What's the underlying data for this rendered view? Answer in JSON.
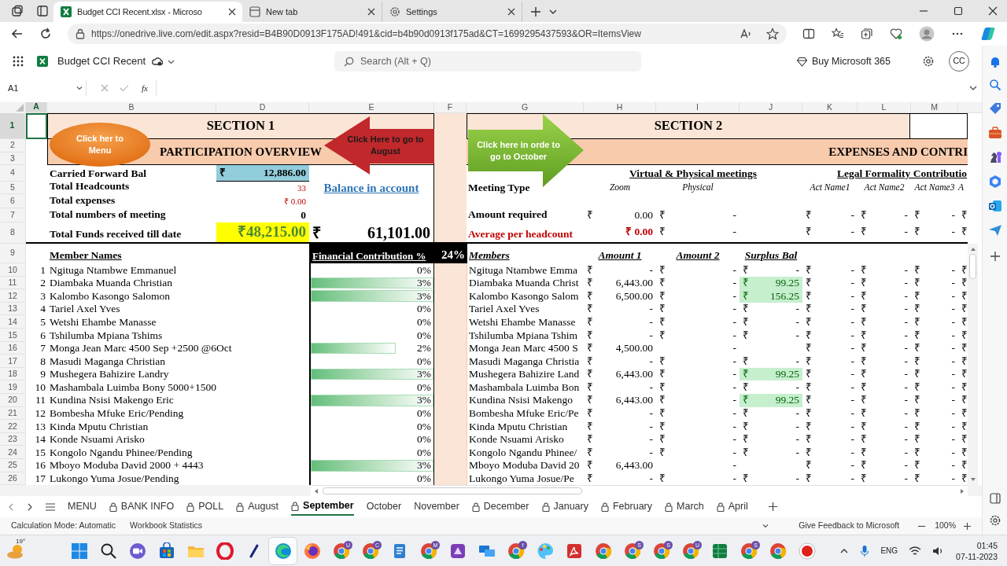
{
  "browser": {
    "tabs": [
      {
        "title": "Budget CCI Recent.xlsx - Microso",
        "kind": "excel",
        "selected": true
      },
      {
        "title": "New tab",
        "kind": "newtab",
        "selected": false
      },
      {
        "title": "Settings",
        "kind": "settings",
        "selected": false
      }
    ],
    "url": "https://onedrive.live.com/edit.aspx?resid=B4B90D0913F175AD!491&cid=b4b90d0913f175ad&CT=1699295437593&OR=ItemsView"
  },
  "app": {
    "title": "Budget CCI Recent",
    "search_placeholder": "Search (Alt + Q)",
    "buy": "Buy Microsoft 365",
    "avatar": "CC"
  },
  "formula_bar": {
    "name_box": "A1",
    "function_label": "fx"
  },
  "columns": [
    {
      "label": "A",
      "selected": true
    },
    {
      "label": "B",
      "selected": false
    },
    {
      "label": "D",
      "selected": false
    },
    {
      "label": "E",
      "selected": false
    },
    {
      "label": "F",
      "selected": false
    },
    {
      "label": "G",
      "selected": false
    },
    {
      "label": "H",
      "selected": false
    },
    {
      "label": "I",
      "selected": false
    },
    {
      "label": "J",
      "selected": false
    },
    {
      "label": "K",
      "selected": false
    },
    {
      "label": "L",
      "selected": false
    },
    {
      "label": "M",
      "selected": false
    }
  ],
  "row_numbers": [
    {
      "label": "1",
      "selected": true
    },
    {
      "label": "2",
      "selected": false
    },
    {
      "label": "3",
      "selected": false
    },
    {
      "label": "4",
      "selected": false
    },
    {
      "label": "5",
      "selected": false
    },
    {
      "label": "6",
      "selected": false
    },
    {
      "label": "7",
      "selected": false
    },
    {
      "label": "8",
      "selected": false
    },
    {
      "label": "9",
      "selected": false
    },
    {
      "label": "10",
      "selected": false
    },
    {
      "label": "11",
      "selected": false
    },
    {
      "label": "12",
      "selected": false
    },
    {
      "label": "13",
      "selected": false
    },
    {
      "label": "14",
      "selected": false
    },
    {
      "label": "15",
      "selected": false
    },
    {
      "label": "16",
      "selected": false
    },
    {
      "label": "17",
      "selected": false
    },
    {
      "label": "18",
      "selected": false
    },
    {
      "label": "19",
      "selected": false
    },
    {
      "label": "20",
      "selected": false
    },
    {
      "label": "21",
      "selected": false
    },
    {
      "label": "22",
      "selected": false
    },
    {
      "label": "23",
      "selected": false
    },
    {
      "label": "24",
      "selected": false
    },
    {
      "label": "25",
      "selected": false
    },
    {
      "label": "26",
      "selected": false
    }
  ],
  "section1": {
    "title": "SECTION 1",
    "subtitle": "PARTICIPATION OVERVIEW",
    "summary": [
      {
        "label": "Carried Forward Bal",
        "value": [
          "₹",
          "12,886.00"
        ],
        "kind": "blue"
      },
      {
        "label": "Total Headcounts",
        "value": [
          "33"
        ],
        "kind": "red"
      },
      {
        "label": "Total expenses",
        "value": [
          "₹ 0.00"
        ],
        "kind": "red"
      },
      {
        "label": "Total numbers of meeting",
        "value": [
          "0"
        ],
        "kind": "plain"
      },
      {
        "label": "Total Funds received till date",
        "value": [
          "₹48,215.00"
        ],
        "kind": "highlight"
      }
    ],
    "balance_label": "Balance in account",
    "balance_value": [
      "₹",
      "61,101.00"
    ],
    "names_header": "Member Names",
    "contribution_header": "Financial Contribution %",
    "contribution_total": "24%"
  },
  "section2": {
    "title": "SECTION 2",
    "subtitle": "EXPENSES AND CONTRI",
    "meetings_header": "Virtual & Physical meetings",
    "legal_header": "Legal Formality Contributio",
    "type_label": "Meeting Type",
    "types": [
      "Zoom",
      "Physical"
    ],
    "acts": [
      "Act Name1",
      "Act Name2",
      "Act Name3",
      "A"
    ],
    "required": {
      "label": "Amount required",
      "cells": [
        [
          "₹",
          "0.00"
        ],
        [
          "₹",
          "-"
        ]
      ],
      "acts": [
        [
          "₹",
          "-"
        ],
        [
          "₹",
          "-"
        ],
        [
          "₹",
          "-"
        ],
        [
          "₹"
        ]
      ]
    },
    "average": {
      "label": "Average per headcount",
      "cells": [
        [
          "₹ 0.00"
        ],
        [
          "₹",
          "-"
        ]
      ],
      "acts": [
        [
          "₹",
          "-"
        ],
        [
          "₹",
          "-"
        ],
        [
          "₹",
          "-"
        ],
        [
          "₹"
        ]
      ]
    },
    "members_header": "Members",
    "amount_headers": [
      "Amount 1",
      "Amount 2",
      "Surplus Bal"
    ]
  },
  "shapes": [
    {
      "kind": "ellipse",
      "text": "Click her to Menu"
    },
    {
      "kind": "arrow_left",
      "text": "Click Here to go to August"
    },
    {
      "kind": "arrow_right",
      "text": "Click here in orde to go to October"
    }
  ],
  "members": [
    {
      "no": "1",
      "name": "Ngituga Ntambwe Emmanuel",
      "pct": "0%",
      "short_name": "Ngituga Ntambwe Emma",
      "amount1": [
        "₹",
        "-"
      ],
      "amount2": [
        "₹",
        "-"
      ],
      "surplus": {
        "cells": [
          "₹",
          "-"
        ],
        "highlight": false
      },
      "acts": [
        [
          "₹",
          "-"
        ],
        [
          "₹",
          "-"
        ],
        [
          "₹",
          "-"
        ],
        [
          "₹"
        ]
      ]
    },
    {
      "no": "2",
      "name": "Diambaka Muanda Christian",
      "pct": "3%",
      "level": 1,
      "short_name": "Diambaka Muanda Christ",
      "amount1": [
        "₹",
        "6,443.00"
      ],
      "amount2": [
        "₹",
        "-"
      ],
      "surplus": {
        "cells": [
          "₹",
          "99.25"
        ],
        "highlight": true
      },
      "acts": [
        [
          "₹",
          "-"
        ],
        [
          "₹",
          "-"
        ],
        [
          "₹",
          "-"
        ],
        [
          "₹"
        ]
      ]
    },
    {
      "no": "3",
      "name": "Kalombo Kasongo Salomon",
      "pct": "3%",
      "level": 1,
      "short_name": "Kalombo Kasongo Salom",
      "amount1": [
        "₹",
        "6,500.00"
      ],
      "amount2": [
        "₹",
        "-"
      ],
      "surplus": {
        "cells": [
          "₹",
          "156.25"
        ],
        "highlight": true
      },
      "acts": [
        [
          "₹",
          "-"
        ],
        [
          "₹",
          "-"
        ],
        [
          "₹",
          "-"
        ],
        [
          "₹"
        ]
      ]
    },
    {
      "no": "4",
      "name": "Tariel Axel Yves",
      "pct": "0%",
      "short_name": "Tariel Axel Yves",
      "amount1": [
        "₹",
        "-"
      ],
      "amount2": [
        "₹",
        "-"
      ],
      "surplus": {
        "cells": [
          "₹",
          "-"
        ],
        "highlight": false
      },
      "acts": [
        [
          "₹",
          "-"
        ],
        [
          "₹",
          "-"
        ],
        [
          "₹",
          "-"
        ],
        [
          "₹"
        ]
      ]
    },
    {
      "no": "5",
      "name": "Wetshi Ehambe Manasse",
      "pct": "0%",
      "short_name": "Wetshi Ehambe Manasse",
      "amount1": [
        "₹",
        "-"
      ],
      "amount2": [
        "₹",
        "-"
      ],
      "surplus": {
        "cells": [
          "₹",
          "-"
        ],
        "highlight": false
      },
      "acts": [
        [
          "₹",
          "-"
        ],
        [
          "₹",
          "-"
        ],
        [
          "₹",
          "-"
        ],
        [
          "₹"
        ]
      ]
    },
    {
      "no": "6",
      "name": "Tshilumba Mpiana Tshims",
      "pct": "0%",
      "short_name": "Tshilumba Mpiana Tshim",
      "amount1": [
        "₹",
        "-"
      ],
      "amount2": [
        "₹",
        "-"
      ],
      "surplus": {
        "cells": [
          "₹",
          "-"
        ],
        "highlight": false
      },
      "acts": [
        [
          "₹",
          "-"
        ],
        [
          "₹",
          "-"
        ],
        [
          "₹",
          "-"
        ],
        [
          "₹"
        ]
      ]
    },
    {
      "no": "7",
      "name": "Monga Jean Marc 4500 Sep +2500 @6Oct",
      "pct": "2%",
      "level": 0.69,
      "short_name": "Monga Jean Marc 4500 S",
      "amount1": [
        "₹",
        "4,500.00"
      ],
      "amount2": [
        "-"
      ],
      "acts": [
        [
          "₹",
          "-"
        ],
        [
          "₹",
          "-"
        ],
        [
          "₹",
          "-"
        ],
        [
          "₹"
        ]
      ]
    },
    {
      "no": "8",
      "name": "Masudi Maganga Christian",
      "pct": "0%",
      "short_name": "Masudi Maganga Christia",
      "amount1": [
        "₹",
        "-"
      ],
      "amount2": [
        "₹",
        "-"
      ],
      "surplus": {
        "cells": [
          "₹",
          "-"
        ],
        "highlight": false
      },
      "acts": [
        [
          "₹",
          "-"
        ],
        [
          "₹",
          "-"
        ],
        [
          "₹",
          "-"
        ],
        [
          "₹"
        ]
      ]
    },
    {
      "no": "9",
      "name": "Mushegera Bahizire Landry",
      "pct": "3%",
      "level": 1,
      "short_name": "Mushegera Bahizire Land",
      "amount1": [
        "₹",
        "6,443.00"
      ],
      "amount2": [
        "₹",
        "-"
      ],
      "surplus": {
        "cells": [
          "₹",
          "99.25"
        ],
        "highlight": true
      },
      "acts": [
        [
          "₹",
          "-"
        ],
        [
          "₹",
          "-"
        ],
        [
          "₹",
          "-"
        ],
        [
          "₹"
        ]
      ]
    },
    {
      "no": "10",
      "name": "Mashambala Luimba Bony 5000+1500",
      "pct": "0%",
      "short_name": "Mashambala Luimba Bon",
      "amount1": [
        "₹",
        "-"
      ],
      "amount2": [
        "₹",
        "-"
      ],
      "surplus": {
        "cells": [
          "₹",
          "-"
        ],
        "highlight": false
      },
      "acts": [
        [
          "₹",
          "-"
        ],
        [
          "₹",
          "-"
        ],
        [
          "₹",
          "-"
        ],
        [
          "₹"
        ]
      ]
    },
    {
      "no": "11",
      "name": "Kundina Nsisi Makengo Eric",
      "pct": "3%",
      "level": 1,
      "short_name": "Kundina Nsisi Makengo",
      "amount1": [
        "₹",
        "6,443.00"
      ],
      "amount2": [
        "₹",
        "-"
      ],
      "surplus": {
        "cells": [
          "₹",
          "99.25"
        ],
        "highlight": true
      },
      "acts": [
        [
          "₹",
          "-"
        ],
        [
          "₹",
          "-"
        ],
        [
          "₹",
          "-"
        ],
        [
          "₹"
        ]
      ]
    },
    {
      "no": "12",
      "name": "Bombesha Mfuke Eric/Pending",
      "pct": "0%",
      "short_name": "Bombesha Mfuke Eric/Pe",
      "amount1": [
        "₹",
        "-"
      ],
      "amount2": [
        "₹",
        "-"
      ],
      "surplus": {
        "cells": [
          "₹",
          "-"
        ],
        "highlight": false
      },
      "acts": [
        [
          "₹",
          "-"
        ],
        [
          "₹",
          "-"
        ],
        [
          "₹",
          "-"
        ],
        [
          "₹"
        ]
      ]
    },
    {
      "no": "13",
      "name": "Kinda Mputu Christian",
      "pct": "0%",
      "short_name": "Kinda Mputu Christian",
      "amount1": [
        "₹",
        "-"
      ],
      "amount2": [
        "₹",
        "-"
      ],
      "surplus": {
        "cells": [
          "₹",
          "-"
        ],
        "highlight": false
      },
      "acts": [
        [
          "₹",
          "-"
        ],
        [
          "₹",
          "-"
        ],
        [
          "₹",
          "-"
        ],
        [
          "₹"
        ]
      ]
    },
    {
      "no": "14",
      "name": "Konde Nsuami Arisko",
      "pct": "0%",
      "short_name": "Konde Nsuami Arisko",
      "amount1": [
        "₹",
        "-"
      ],
      "amount2": [
        "₹",
        "-"
      ],
      "surplus": {
        "cells": [
          "₹",
          "-"
        ],
        "highlight": false
      },
      "acts": [
        [
          "₹",
          "-"
        ],
        [
          "₹",
          "-"
        ],
        [
          "₹",
          "-"
        ],
        [
          "₹"
        ]
      ]
    },
    {
      "no": "15",
      "name": "Kongolo Ngandu Phinee/Pending",
      "pct": "0%",
      "short_name": "Kongolo Ngandu Phinee/",
      "amount1": [
        "₹",
        "-"
      ],
      "amount2": [
        "₹",
        "-"
      ],
      "surplus": {
        "cells": [
          "₹",
          "-"
        ],
        "highlight": false
      },
      "acts": [
        [
          "₹",
          "-"
        ],
        [
          "₹",
          "-"
        ],
        [
          "₹",
          "-"
        ],
        [
          "₹"
        ]
      ]
    },
    {
      "no": "16",
      "name": "Mboyo Moduba David 2000 + 4443",
      "pct": "3%",
      "level": 1,
      "short_name": "Mboyo Moduba David 20",
      "amount1": [
        "₹",
        "6,443.00"
      ],
      "amount2": [
        "-"
      ],
      "acts": [
        [
          "₹",
          "-"
        ],
        [
          "₹",
          "-"
        ],
        [
          "₹",
          "-"
        ],
        [
          "₹"
        ]
      ]
    },
    {
      "no": "17",
      "name": "Lukongo Yuma Josue/Pending",
      "pct": "0%",
      "short_name": "Lukongo Yuma Josue/Pe",
      "amount1": [
        "₹",
        "-"
      ],
      "amount2": [
        "₹",
        "-"
      ],
      "surplus": {
        "cells": [
          "₹",
          "-"
        ],
        "highlight": false
      },
      "acts": [
        [
          "₹",
          "-"
        ],
        [
          "₹",
          "-"
        ],
        [
          "₹",
          "-"
        ],
        [
          "₹"
        ]
      ]
    }
  ],
  "sheet_tabs": [
    {
      "label": "MENU",
      "locked": false,
      "selected": false
    },
    {
      "label": "BANK INFO",
      "locked": true,
      "selected": false
    },
    {
      "label": "POLL",
      "locked": true,
      "selected": false
    },
    {
      "label": "August",
      "locked": true,
      "selected": false
    },
    {
      "label": "September",
      "locked": true,
      "selected": true
    },
    {
      "label": "October",
      "locked": false,
      "selected": false
    },
    {
      "label": "November",
      "locked": false,
      "selected": false
    },
    {
      "label": "December",
      "locked": true,
      "selected": false
    },
    {
      "label": "January",
      "locked": true,
      "selected": false
    },
    {
      "label": "February",
      "locked": true,
      "selected": false
    },
    {
      "label": "March",
      "locked": true,
      "selected": false
    },
    {
      "label": "April",
      "locked": true,
      "selected": false
    }
  ],
  "status_bar": {
    "items": [
      "Calculation Mode: Automatic",
      "Workbook Statistics"
    ],
    "feedback": "Give Feedback to Microsoft",
    "zoom": "100%"
  },
  "taskbar": {
    "weather": "19°",
    "apps": [
      {
        "kind": "windows",
        "selected": false
      },
      {
        "kind": "search",
        "selected": false
      },
      {
        "kind": "meet",
        "selected": false
      },
      {
        "kind": "store",
        "selected": false
      },
      {
        "kind": "files",
        "selected": false
      },
      {
        "kind": "opera",
        "selected": false
      },
      {
        "kind": "pen",
        "selected": false
      },
      {
        "kind": "edge",
        "selected": true
      },
      {
        "kind": "firefox",
        "selected": false
      },
      {
        "kind": "chrome",
        "badge": "U",
        "selected": false
      },
      {
        "kind": "chrome",
        "badge": "C",
        "selected": false
      },
      {
        "kind": "notepad",
        "selected": false
      },
      {
        "kind": "chrome",
        "badge": "M",
        "selected": false
      },
      {
        "kind": "purple",
        "selected": false
      },
      {
        "kind": "remote",
        "selected": false
      },
      {
        "kind": "chrome",
        "badge": "f",
        "selected": false
      },
      {
        "kind": "paint",
        "selected": false
      },
      {
        "kind": "acrobat",
        "selected": false
      },
      {
        "kind": "chrome",
        "selected": false
      },
      {
        "kind": "chrome",
        "badge": "S",
        "selected": false
      },
      {
        "kind": "chrome",
        "badge": "S",
        "selected": false
      },
      {
        "kind": "chrome",
        "badge": "U",
        "selected": false
      },
      {
        "kind": "excel",
        "selected": false
      },
      {
        "kind": "chrome",
        "badge": "S",
        "selected": false
      },
      {
        "kind": "chrome",
        "selected": false
      },
      {
        "kind": "record",
        "selected": false
      }
    ],
    "language": "ENG",
    "time": "01:45",
    "date": "07-11-2023"
  }
}
